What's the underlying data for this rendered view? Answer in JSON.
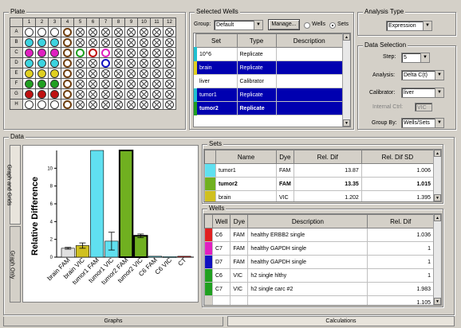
{
  "plate": {
    "title": "Plate",
    "col_headers": [
      "",
      "1",
      "2",
      "3",
      "4",
      "5",
      "6",
      "7",
      "8",
      "9",
      "10",
      "11",
      "12"
    ],
    "row_headers": [
      "A",
      "B",
      "C",
      "D",
      "E",
      "F",
      "G",
      "H"
    ],
    "colors": {
      "cyan": "#3cd4e0",
      "magenta": "#e020c0",
      "green": "#20a020",
      "yellow": "#e0d020",
      "red": "#c01010",
      "blue": "#1010c0",
      "brown": "#704010"
    }
  },
  "selected_wells": {
    "title": "Selected Wells",
    "group_label": "Group:",
    "group_value": "Default",
    "manage_label": "Manage...",
    "radio_wells": "Wells",
    "radio_sets": "Sets",
    "headers": [
      "Set",
      "Type",
      "Description"
    ],
    "rows": [
      {
        "set": "10^6",
        "type": "Replicate",
        "desc": "",
        "color": "#20c0d0",
        "selected": false
      },
      {
        "set": "brain",
        "type": "Replicate",
        "desc": "",
        "color": "#e0d020",
        "selected": true
      },
      {
        "set": "liver",
        "type": "Calibrator",
        "desc": "",
        "color": "#ffffff",
        "selected": false
      },
      {
        "set": "tumor1",
        "type": "Replicate",
        "desc": "",
        "color": "#20c0d0",
        "selected": true
      },
      {
        "set": "tumor2",
        "type": "Replicate",
        "desc": "",
        "color": "#20a020",
        "selected": true
      }
    ]
  },
  "analysis_type": {
    "title": "Analysis Type",
    "value": "Expression"
  },
  "data_selection": {
    "title": "Data Selection",
    "step_label": "Step:",
    "step_value": "5",
    "analysis_label": "Analysis:",
    "analysis_value": "Delta C(t)",
    "calibrator_label": "Calibrator:",
    "calibrator_value": "liver",
    "internal_label": "Internal Ctrl:",
    "internal_value": "VIC",
    "groupby_label": "Group By:",
    "groupby_value": "Wells/Sets"
  },
  "data_panel": {
    "title": "Data",
    "side_tab1": "Graph and Grids",
    "side_tab2": "Graph Only",
    "bottom_tab1": "Graphs",
    "bottom_tab2": "Calculations"
  },
  "chart_data": {
    "type": "bar",
    "ylabel": "Relative Difference",
    "yticks": [
      "0",
      "2",
      "4",
      "6",
      "8",
      "10"
    ],
    "ylim": [
      0,
      12
    ],
    "categories": [
      "brain FAM",
      "brain VIC",
      "tumor1 FAM",
      "tumor1 VIC",
      "tumor2 FAM",
      "tumor2 VIC",
      "C6 FAM",
      "C6 VIC",
      "CT"
    ],
    "values": [
      1.0,
      1.3,
      13.9,
      1.8,
      13.4,
      2.4,
      0.1,
      0.05,
      0.1
    ],
    "errors": [
      0.1,
      0.3,
      0,
      1.0,
      0,
      0.2,
      0,
      0,
      0
    ],
    "colors": [
      "#e0e0e0",
      "#d0c020",
      "#60e0f0",
      "#60e0f0",
      "#70b020",
      "#70b020",
      "#60e0f0",
      "#60e0f0",
      "#e02020"
    ]
  },
  "sets_grid": {
    "title": "Sets",
    "headers": [
      "",
      "Name",
      "Dye",
      "Rel. Dif",
      "Rel. Dif SD"
    ],
    "rows": [
      {
        "color": "#60e0f0",
        "name": "tumor1",
        "dye": "FAM",
        "dif": "13.87",
        "sd": "1.006",
        "bold": false
      },
      {
        "color": "#70b020",
        "name": "tumor2",
        "dye": "FAM",
        "dif": "13.35",
        "sd": "1.015",
        "bold": true
      },
      {
        "color": "#d0c020",
        "name": "brain",
        "dye": "VIC",
        "dif": "1.202",
        "sd": "1.395",
        "bold": false
      }
    ]
  },
  "wells_grid": {
    "title": "Wells",
    "headers": [
      "",
      "Well",
      "Dye",
      "Description",
      "Rel. Dif"
    ],
    "rows": [
      {
        "color": "#e02020",
        "well": "C6",
        "dye": "FAM",
        "desc": "healthy ERBB2 single",
        "dif": "1.036"
      },
      {
        "color": "#e020c0",
        "well": "C7",
        "dye": "FAM",
        "desc": "healthy GAPDH single",
        "dif": "1"
      },
      {
        "color": "#1010c0",
        "well": "D7",
        "dye": "FAM",
        "desc": "healthy GAPDH single",
        "dif": "1"
      },
      {
        "color": "#20a020",
        "well": "C6",
        "dye": "VIC",
        "desc": "h2 single hlthy",
        "dif": "1"
      },
      {
        "color": "#20a020",
        "well": "C7",
        "dye": "VIC",
        "desc": "h2 single carc #2",
        "dif": "1.983"
      },
      {
        "color": "#d4d0c8",
        "well": "",
        "dye": "",
        "desc": "",
        "dif": "1.105"
      }
    ]
  }
}
